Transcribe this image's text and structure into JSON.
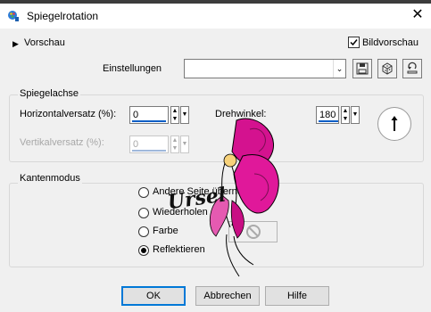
{
  "window": {
    "title": "Spiegelrotation",
    "close_glyph": "✕"
  },
  "preview": {
    "label": "Vorschau",
    "bildvorschau_label": "Bildvorschau",
    "bildvorschau_checked": true
  },
  "settings": {
    "label": "Einstellungen",
    "value": ""
  },
  "spiegelachse": {
    "label": "Spiegelachse",
    "horizontal_label": "Horizontalversatz (%):",
    "horizontal_value": "0",
    "vertical_label": "Vertikalversatz (%):",
    "vertical_value": "0",
    "drehwinkel_label": "Drehwinkel:",
    "drehwinkel_value": "180"
  },
  "kantenmodus": {
    "label": "Kantenmodus",
    "options": [
      {
        "label": "Andere Seite übernehmen",
        "selected": false
      },
      {
        "label": "Wiederholen",
        "selected": false
      },
      {
        "label": "Farbe",
        "selected": false
      },
      {
        "label": "Reflektieren",
        "selected": true
      }
    ]
  },
  "watermark": {
    "text": "Ursel"
  },
  "buttons": {
    "ok": "OK",
    "cancel": "Abbrechen",
    "help": "Hilfe"
  }
}
